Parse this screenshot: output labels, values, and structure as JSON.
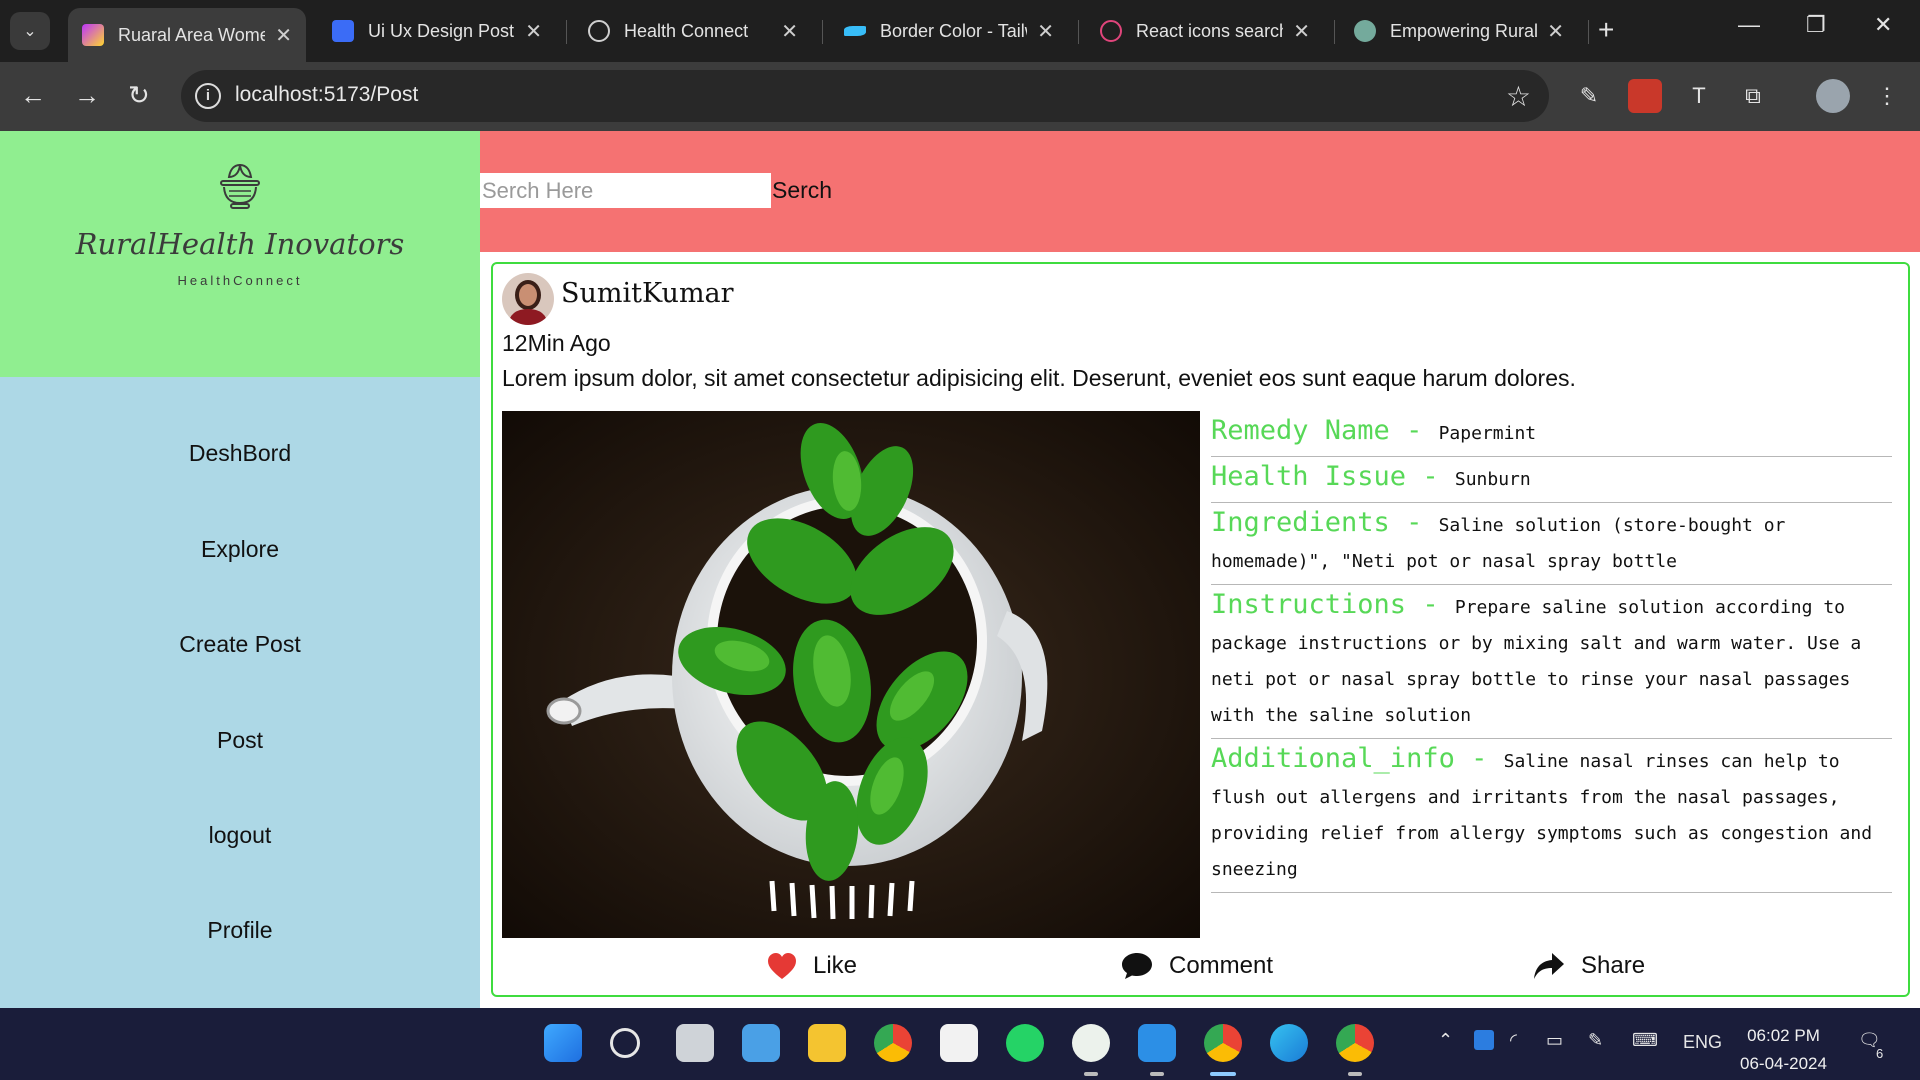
{
  "browser": {
    "tabs": [
      {
        "title": "Ruaral Area Women",
        "active": true
      },
      {
        "title": "Ui Ux Design Post",
        "active": false
      },
      {
        "title": "Health Connect",
        "active": false
      },
      {
        "title": "Border Color - Tailwind",
        "active": false
      },
      {
        "title": "React icons search",
        "active": false
      },
      {
        "title": "Empowering Rural",
        "active": false
      }
    ],
    "url": "localhost:5173/Post"
  },
  "sidebar": {
    "brand": "RuralHealth Inovators",
    "brand_sub": "HealthConnect",
    "nav": [
      "DeshBord",
      "Explore",
      "Create Post",
      "Post",
      "logout",
      "Profile"
    ]
  },
  "search": {
    "placeholder": "Serch Here",
    "button_label": "Serch"
  },
  "post": {
    "author": "SumitKumar",
    "time": "12Min Ago",
    "description": "Lorem ipsum dolor, sit amet consectetur adipisicing elit. Deserunt, eveniet eos sunt eaque harum dolores.",
    "details": [
      {
        "label": "Remedy Name",
        "sep": " - ",
        "value": "Papermint"
      },
      {
        "label": "Health Issue",
        "sep": " - ",
        "value": "Sunburn"
      },
      {
        "label": "Ingredients",
        "sep": " - ",
        "value": "Saline solution (store-bought or homemade)\", \"Neti pot or nasal spray bottle"
      },
      {
        "label": "Instructions",
        "sep": " - ",
        "value": "Prepare saline solution according to package instructions or by mixing salt and warm water. Use a neti pot or nasal spray bottle to rinse your nasal passages with the saline solution"
      },
      {
        "label": "Additional_info",
        "sep": " - ",
        "value": "Saline nasal rinses can help to flush out allergens and irritants from the nasal passages, providing relief from allergy symptoms such as congestion and sneezing"
      }
    ],
    "actions": {
      "like": "Like",
      "comment": "Comment",
      "share": "Share"
    }
  },
  "taskbar": {
    "language": "ENG",
    "time": "06:02 PM",
    "date": "06-04-2024",
    "notifications": "6"
  },
  "colors": {
    "sidebar_top": "#90ee90",
    "sidebar_nav": "#add8e6",
    "search_bar": "#f57272",
    "card_border": "#3fdc3f",
    "detail_label": "#57d857",
    "like_heart": "#e53935"
  }
}
